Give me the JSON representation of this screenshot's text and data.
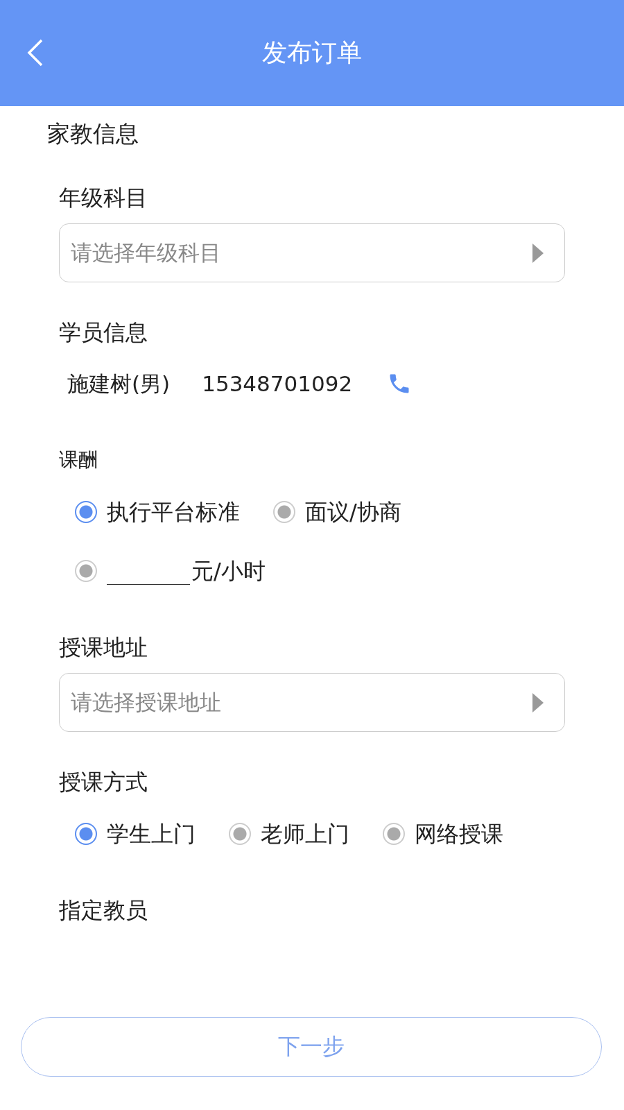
{
  "header": {
    "title": "发布订单"
  },
  "section_title": "家教信息",
  "fields": [
    {
      "kind": "select",
      "label": "年级科目",
      "placeholder": "请选择年级科目"
    },
    {
      "kind": "student",
      "label": "学员信息",
      "name": "施建树(男)",
      "phone": "15348701092"
    },
    {
      "kind": "fee",
      "label": "课酬",
      "options": [
        {
          "label": "执行平台标准",
          "selected": true
        },
        {
          "label": "面议/协商",
          "selected": false
        }
      ],
      "custom": {
        "unit": "元/小时",
        "selected": false
      }
    },
    {
      "kind": "select",
      "label": "授课地址",
      "placeholder": "请选择授课地址"
    },
    {
      "kind": "radio",
      "label": "授课方式",
      "options": [
        {
          "label": "学生上门",
          "selected": true
        },
        {
          "label": "老师上门",
          "selected": false
        },
        {
          "label": "网络授课",
          "selected": false
        }
      ]
    },
    {
      "kind": "empty",
      "label": "指定教员"
    }
  ],
  "next_button": "下一步"
}
